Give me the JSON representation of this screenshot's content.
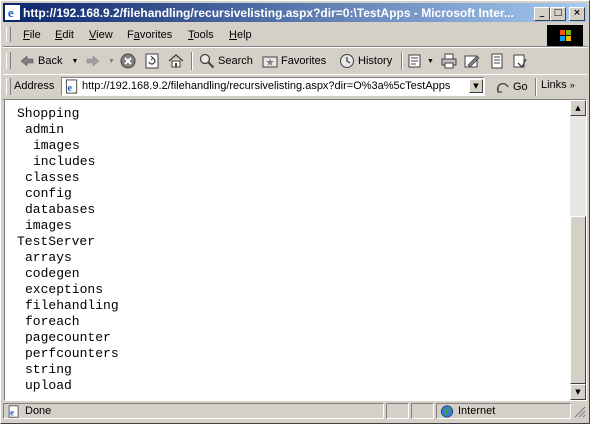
{
  "window": {
    "title": "http://192.168.9.2/filehandling/recursivelisting.aspx?dir=0:\\TestApps - Microsoft Inter...",
    "controls": [
      "_",
      "□",
      "×"
    ]
  },
  "menubar": {
    "items": [
      {
        "label": "File",
        "mnemonic": "F",
        "rest": "ile"
      },
      {
        "label": "Edit",
        "mnemonic": "E",
        "rest": "dit"
      },
      {
        "label": "View",
        "mnemonic": "V",
        "rest": "iew"
      },
      {
        "label": "Favorites",
        "mnemonic": "a",
        "pre": "F",
        "rest": "vorites"
      },
      {
        "label": "Tools",
        "mnemonic": "T",
        "rest": "ools"
      },
      {
        "label": "Help",
        "mnemonic": "H",
        "rest": "elp"
      }
    ]
  },
  "toolbar": {
    "back_label": "Back",
    "search_label": "Search",
    "favorites_label": "Favorites",
    "history_label": "History"
  },
  "address_bar": {
    "label": "Address",
    "url": "http://192.168.9.2/filehandling/recursivelisting.aspx?dir=O%3a%5cTestApps",
    "go_label": "Go",
    "links_label": "Links"
  },
  "listing": {
    "entries": [
      {
        "name": "Shopping",
        "depth": 0
      },
      {
        "name": "admin",
        "depth": 1
      },
      {
        "name": "images",
        "depth": 2
      },
      {
        "name": "includes",
        "depth": 2
      },
      {
        "name": "classes",
        "depth": 1
      },
      {
        "name": "config",
        "depth": 1
      },
      {
        "name": "databases",
        "depth": 1
      },
      {
        "name": "images",
        "depth": 1
      },
      {
        "name": "TestServer",
        "depth": 0
      },
      {
        "name": "arrays",
        "depth": 1
      },
      {
        "name": "codegen",
        "depth": 1
      },
      {
        "name": "exceptions",
        "depth": 1
      },
      {
        "name": "filehandling",
        "depth": 1
      },
      {
        "name": "foreach",
        "depth": 1
      },
      {
        "name": "pagecounter",
        "depth": 1
      },
      {
        "name": "perfcounters",
        "depth": 1
      },
      {
        "name": "string",
        "depth": 1
      },
      {
        "name": "upload",
        "depth": 1
      }
    ]
  },
  "statusbar": {
    "status_text": "Done",
    "zone_text": "Internet"
  },
  "colors": {
    "titlebar_start": "#0a246a",
    "titlebar_end": "#a6caf0",
    "chrome": "#d4d0c8"
  }
}
